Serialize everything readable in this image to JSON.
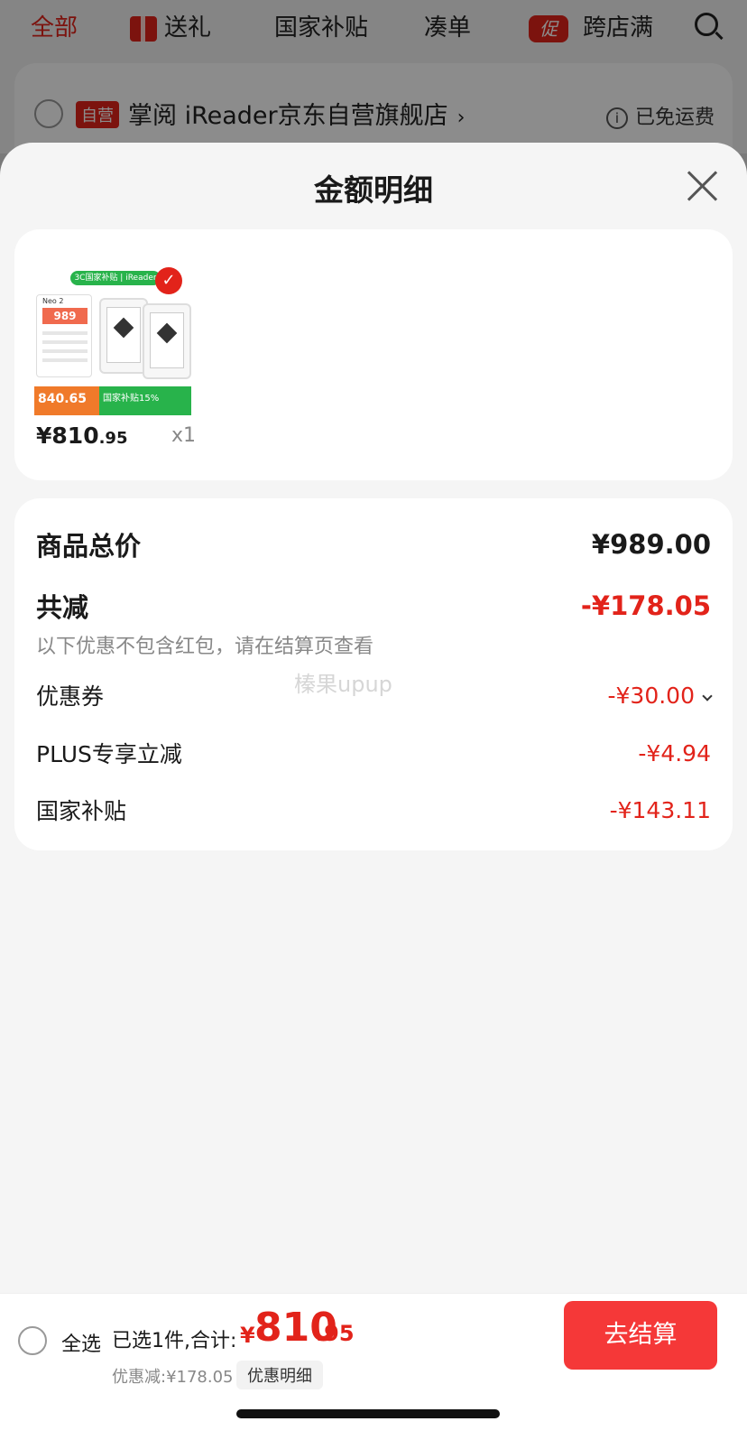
{
  "tabs": {
    "all": "全部",
    "gift": "送礼",
    "subsidy": "国家补贴",
    "combine": "凑单",
    "promo_badge": "促",
    "cross_store": "跨店满"
  },
  "store": {
    "badge": "自营",
    "name": "掌阅 iReader京东自营旗舰店",
    "chevron": "›",
    "info_glyph": "i",
    "shipping": "已免运费"
  },
  "sheet": {
    "title": "金额明细"
  },
  "product": {
    "image": {
      "green_tag": "3C国家补贴 | iReader",
      "phone_price": "989",
      "orange_price": "840.65",
      "green_banner": "国家补贴15%",
      "device_model": "Neo 2"
    },
    "price_yen": "¥",
    "price_int": "810",
    "price_dec": ".95",
    "quantity": "x1"
  },
  "details": {
    "total_label": "商品总价",
    "total_value": "¥989.00",
    "reduce_label": "共减",
    "reduce_value": "-¥178.05",
    "reduce_hint": "以下优惠不包含红包，请在结算页查看",
    "coupon_label": "优惠券",
    "coupon_value": "-¥30.00",
    "plus_label": "PLUS专享立减",
    "plus_value": "-¥4.94",
    "subsidy_label": "国家补贴",
    "subsidy_value": "-¥143.11"
  },
  "watermark": "榛果upup",
  "bottom": {
    "select_all": "全选",
    "selected_text": "已选1件,合计:",
    "sum_yen": "¥",
    "sum_int": "810",
    "sum_dec": ".95",
    "discount_text": "优惠减:¥178.05",
    "detail_button": "优惠明细",
    "checkout_button": "去结算"
  },
  "colors": {
    "accent_red": "#e2231a",
    "checkout_red": "#f53838",
    "subsidy_green": "#28b34b"
  }
}
